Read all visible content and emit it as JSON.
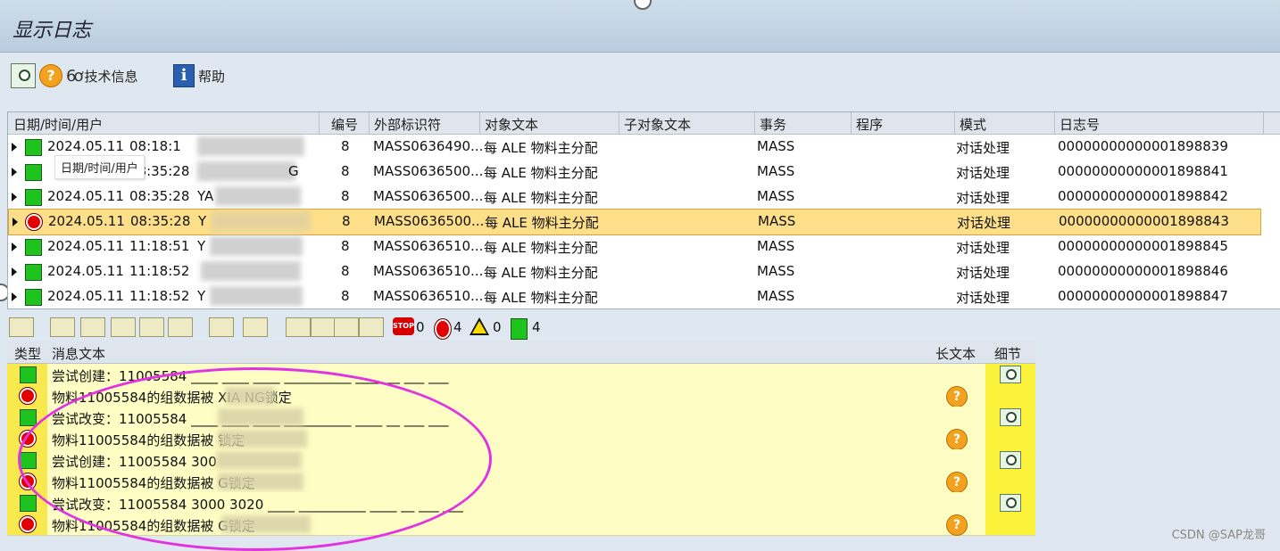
{
  "window": {
    "title": "显示日志"
  },
  "toolbar": {
    "tech_info_label": "技术信息",
    "help_label": "帮助"
  },
  "log_table": {
    "columns": [
      "日期/时间/用户",
      "编号",
      "外部标识符",
      "对象文本",
      "子对象文本",
      "事务",
      "程序",
      "模式",
      "日志号"
    ],
    "tooltip": "日期/时间/用户",
    "rows": [
      {
        "date": "2024.05.11",
        "time": "08:18:1",
        "user": "",
        "num": "8",
        "ext_id": "MASS0636490...",
        "obj_text": "每 ALE 物料主分配",
        "trans": "MASS",
        "mode": "对话处理",
        "log_no": "00000000000001898839",
        "status": "green"
      },
      {
        "date": "2024.05.11",
        "time": "08:35:28",
        "user": "G",
        "num": "8",
        "ext_id": "MASS0636500...",
        "obj_text": "每 ALE 物料主分配",
        "trans": "MASS",
        "mode": "对话处理",
        "log_no": "00000000000001898841",
        "status": "green"
      },
      {
        "date": "2024.05.11",
        "time": "08:35:28",
        "user": "YA",
        "num": "8",
        "ext_id": "MASS0636500...",
        "obj_text": "每 ALE 物料主分配",
        "trans": "MASS",
        "mode": "对话处理",
        "log_no": "00000000000001898842",
        "status": "green"
      },
      {
        "date": "2024.05.11",
        "time": "08:35:28",
        "user": "Y",
        "num": "8",
        "ext_id": "MASS0636500...",
        "obj_text": "每 ALE 物料主分配",
        "trans": "MASS",
        "mode": "对话处理",
        "log_no": "00000000000001898843",
        "status": "red"
      },
      {
        "date": "2024.05.11",
        "time": "11:18:51",
        "user": "Y",
        "num": "8",
        "ext_id": "MASS0636510...",
        "obj_text": "每 ALE 物料主分配",
        "trans": "MASS",
        "mode": "对话处理",
        "log_no": "00000000000001898845",
        "status": "green"
      },
      {
        "date": "2024.05.11",
        "time": "11:18:52",
        "user": "",
        "num": "8",
        "ext_id": "MASS0636510...",
        "obj_text": "每 ALE 物料主分配",
        "trans": "MASS",
        "mode": "对话处理",
        "log_no": "00000000000001898846",
        "status": "green"
      },
      {
        "date": "2024.05.11",
        "time": "11:18:52",
        "user": "Y",
        "num": "8",
        "ext_id": "MASS0636510...",
        "obj_text": "每 ALE 物料主分配",
        "trans": "MASS",
        "mode": "对话处理",
        "log_no": "00000000000001898847",
        "status": "green"
      }
    ]
  },
  "msg_toolbar": {
    "stop_label": "STOP",
    "count_stop": "0",
    "count_error": "4",
    "count_warning": "0",
    "count_success": "4"
  },
  "messages": {
    "columns": [
      "类型",
      "消息文本",
      "长文本",
      "细节"
    ],
    "rows": [
      {
        "text": "尝试创建：11005584 ____ ____ ____ __________ ____ __ ___ ___",
        "type": "green"
      },
      {
        "text": "物料11005584的组数据被 XIA    NG锁定",
        "type": "red"
      },
      {
        "text": "尝试改变：11005584 ____ ____ ____ __________ ____ __ ___ ___",
        "type": "green"
      },
      {
        "text": "物料11005584的组数据被             锁定",
        "type": "red"
      },
      {
        "text": "尝试创建：11005584 300",
        "type": "green"
      },
      {
        "text": "物料11005584的组数据被            G锁定",
        "type": "red"
      },
      {
        "text": "尝试改变：11005584 3000 3020 ____ __________ ____ __ ___ ___",
        "type": "green"
      },
      {
        "text": "物料11005584的组数据被            G锁定",
        "type": "red"
      }
    ]
  },
  "watermark": "CSDN @SAP龙哥",
  "colors": {
    "selected_row": "#fddf8a",
    "msg_bg": "#fefdc3",
    "highlight_ellipse": "#e233e2"
  }
}
